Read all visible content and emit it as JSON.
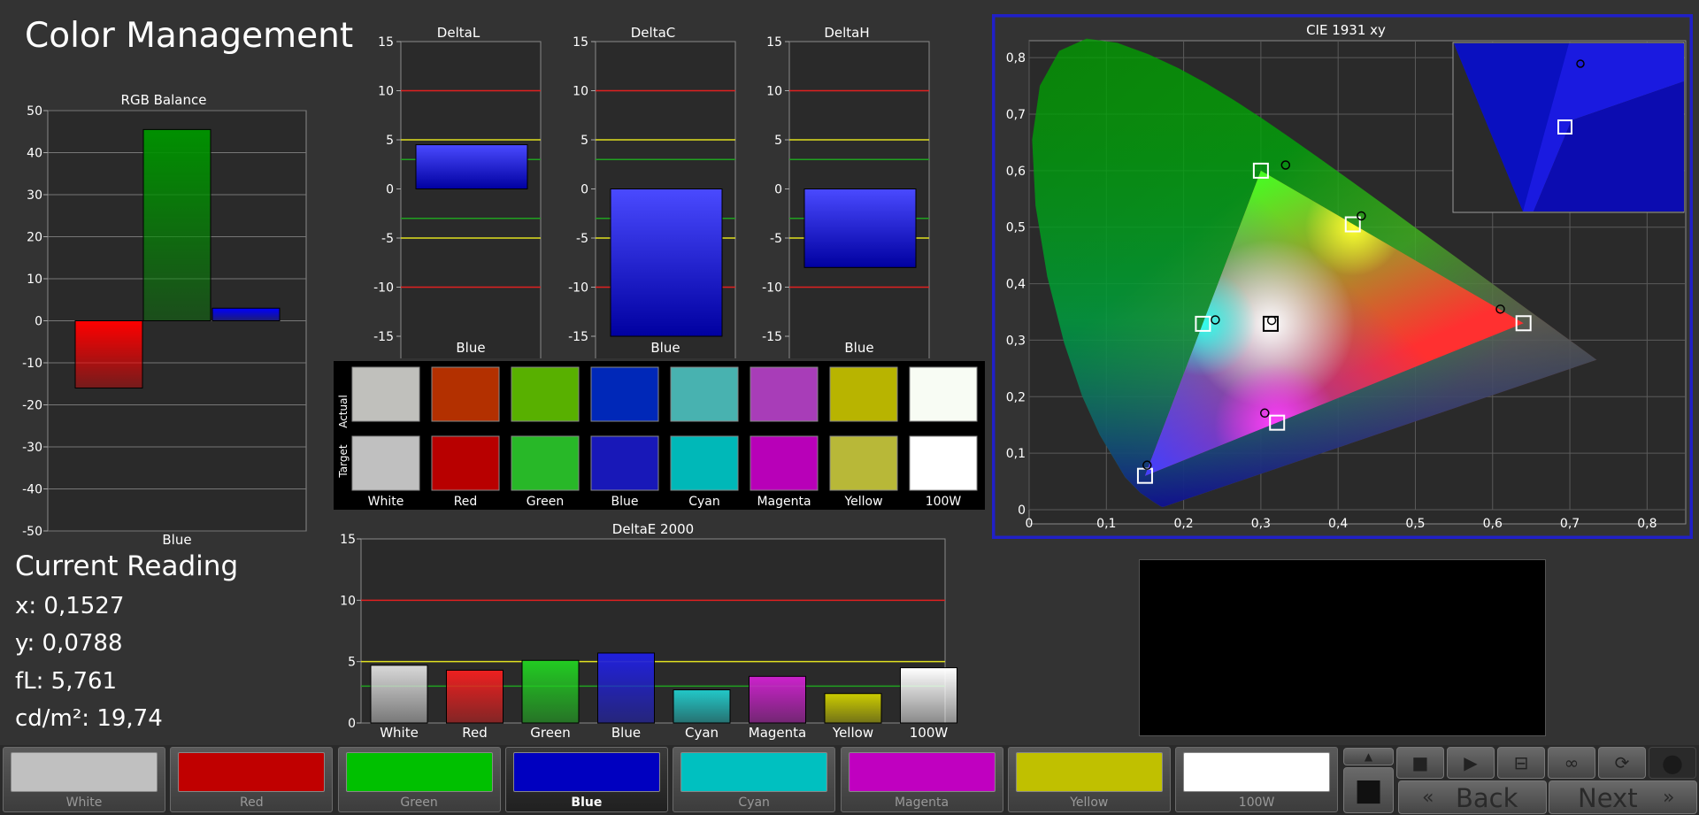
{
  "app": {
    "title": "Color Management"
  },
  "rgb_balance": {
    "title": "RGB Balance",
    "category": "Blue",
    "yticks": [
      "50",
      "40",
      "30",
      "20",
      "10",
      "0",
      "-10",
      "-20",
      "-30",
      "-40",
      "-50"
    ]
  },
  "delta_charts": {
    "yticks": [
      "15",
      "10",
      "5",
      "0",
      "-5",
      "-10",
      "-15"
    ],
    "deltaL": {
      "title": "DeltaL",
      "category": "Blue"
    },
    "deltaC": {
      "title": "DeltaC",
      "category": "Blue"
    },
    "deltaH": {
      "title": "DeltaH",
      "category": "Blue"
    }
  },
  "swatch_grid": {
    "row_labels": {
      "actual": "Actual",
      "target": "Target"
    },
    "names": [
      "White",
      "Red",
      "Green",
      "Blue",
      "Cyan",
      "Magenta",
      "Yellow",
      "100W"
    ],
    "actual_colors": [
      "#c0c0bc",
      "#b33000",
      "#58b000",
      "#0028b8",
      "#48b2b0",
      "#a83db8",
      "#b8b400",
      "#f8fcf4"
    ],
    "target_colors": [
      "#c0c0c0",
      "#b80000",
      "#28b828",
      "#1818b8",
      "#00b8b8",
      "#b800b8",
      "#b8b838",
      "#ffffff"
    ]
  },
  "deltae": {
    "title": "DeltaE 2000",
    "yticks": [
      "15",
      "10",
      "5",
      "0"
    ],
    "categories": [
      "White",
      "Red",
      "Green",
      "Blue",
      "Cyan",
      "Magenta",
      "Yellow",
      "100W"
    ]
  },
  "cie": {
    "title": "CIE 1931 xy",
    "xticks": [
      "0",
      "0,1",
      "0,2",
      "0,3",
      "0,4",
      "0,5",
      "0,6",
      "0,7",
      "0,8"
    ],
    "yticks": [
      "0,8",
      "0,7",
      "0,6",
      "0,5",
      "0,4",
      "0,3",
      "0,2",
      "0,1",
      "0"
    ]
  },
  "current_reading": {
    "title": "Current Reading",
    "x": "x: 0,1527",
    "y": "y: 0,0788",
    "fl": "fL: 5,761",
    "cdm2": "cd/m²: 19,74"
  },
  "bottom_bar": {
    "swatches": [
      {
        "label": "White",
        "color": "#c0c0c0"
      },
      {
        "label": "Red",
        "color": "#c00000"
      },
      {
        "label": "Green",
        "color": "#00c000"
      },
      {
        "label": "Blue",
        "color": "#0000c0"
      },
      {
        "label": "Cyan",
        "color": "#00c0c0"
      },
      {
        "label": "Magenta",
        "color": "#c000c0"
      },
      {
        "label": "Yellow",
        "color": "#c0c000"
      },
      {
        "label": "100W",
        "color": "#ffffff"
      }
    ],
    "selected": "Blue",
    "back_label": "Back",
    "next_label": "Next",
    "icons": [
      "stop-icon",
      "play-icon",
      "fit-icon",
      "infinity-icon",
      "refresh-icon",
      "circle-icon",
      "up-arrow-icon",
      "window-icon"
    ]
  },
  "chart_data": [
    {
      "type": "bar",
      "title": "RGB Balance",
      "categories": [
        "Blue"
      ],
      "series": [
        {
          "name": "Red",
          "values": [
            -16
          ]
        },
        {
          "name": "Green",
          "values": [
            45.5
          ]
        },
        {
          "name": "Blue",
          "values": [
            3
          ]
        }
      ],
      "ylim": [
        -50,
        50
      ],
      "colors": [
        "#ff0000",
        "#009000",
        "#0000ff"
      ]
    },
    {
      "type": "bar",
      "title": "DeltaL",
      "categories": [
        "Blue"
      ],
      "values": [
        4.5
      ],
      "ylim": [
        -15,
        15
      ],
      "reference_lines": [
        10,
        5,
        3,
        -3,
        -5,
        -10
      ]
    },
    {
      "type": "bar",
      "title": "DeltaC",
      "categories": [
        "Blue"
      ],
      "values": [
        -15
      ],
      "ylim": [
        -15,
        15
      ],
      "reference_lines": [
        10,
        5,
        3,
        -3,
        -5,
        -10
      ]
    },
    {
      "type": "bar",
      "title": "DeltaH",
      "categories": [
        "Blue"
      ],
      "values": [
        -8
      ],
      "ylim": [
        -15,
        15
      ],
      "reference_lines": [
        10,
        5,
        3,
        -3,
        -5,
        -10
      ]
    },
    {
      "type": "bar",
      "title": "DeltaE 2000",
      "categories": [
        "White",
        "Red",
        "Green",
        "Blue",
        "Cyan",
        "Magenta",
        "Yellow",
        "100W"
      ],
      "values": [
        4.7,
        4.3,
        5.1,
        5.7,
        2.7,
        3.8,
        2.4,
        4.5
      ],
      "colors": [
        "#d8d8d8",
        "#ee2020",
        "#22cc22",
        "#2020dd",
        "#22c8c8",
        "#cc22cc",
        "#cccc00",
        "#ffffff"
      ],
      "ylim": [
        0,
        15
      ],
      "reference_lines": [
        10,
        5,
        3
      ]
    },
    {
      "type": "scatter",
      "title": "CIE 1931 xy",
      "xlim": [
        0,
        0.85
      ],
      "ylim": [
        0,
        0.83
      ],
      "targets": [
        {
          "name": "White",
          "x": 0.3127,
          "y": 0.329
        },
        {
          "name": "Red",
          "x": 0.64,
          "y": 0.33
        },
        {
          "name": "Green",
          "x": 0.3,
          "y": 0.6
        },
        {
          "name": "Blue",
          "x": 0.15,
          "y": 0.06
        },
        {
          "name": "Cyan",
          "x": 0.225,
          "y": 0.329
        },
        {
          "name": "Magenta",
          "x": 0.321,
          "y": 0.154
        },
        {
          "name": "Yellow",
          "x": 0.419,
          "y": 0.505
        }
      ],
      "actuals": [
        {
          "name": "White",
          "x": 0.314,
          "y": 0.335
        },
        {
          "name": "Red",
          "x": 0.61,
          "y": 0.355
        },
        {
          "name": "Green",
          "x": 0.332,
          "y": 0.61
        },
        {
          "name": "Blue",
          "x": 0.1527,
          "y": 0.0788
        },
        {
          "name": "Cyan",
          "x": 0.241,
          "y": 0.336
        },
        {
          "name": "Magenta",
          "x": 0.305,
          "y": 0.171
        },
        {
          "name": "Yellow",
          "x": 0.43,
          "y": 0.52
        }
      ]
    }
  ]
}
